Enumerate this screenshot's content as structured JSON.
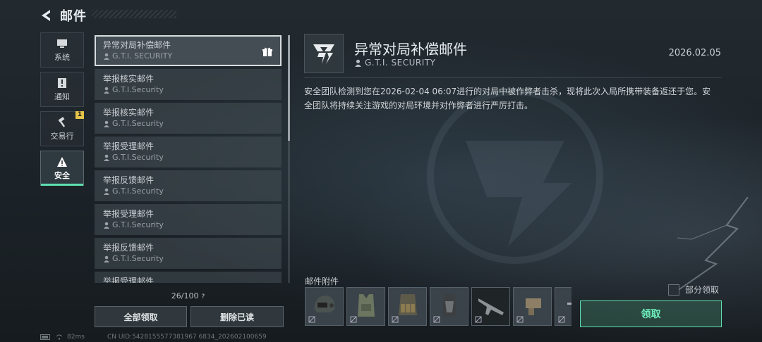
{
  "header": {
    "title": "邮件"
  },
  "sidebar": {
    "items": [
      {
        "label": "系统",
        "icon": "monitor-icon"
      },
      {
        "label": "通知",
        "icon": "notice-icon"
      },
      {
        "label": "交易行",
        "icon": "hammer-icon",
        "badge": "1"
      },
      {
        "label": "安全",
        "icon": "warning-icon",
        "active": true
      }
    ]
  },
  "mail_list": {
    "items": [
      {
        "subject": "异常对局补偿邮件",
        "sender": "G.T.I. SECURITY",
        "has_gift": true,
        "selected": true
      },
      {
        "subject": "举报核实邮件",
        "sender": "G.T.I.Security"
      },
      {
        "subject": "举报核实邮件",
        "sender": "G.T.I.Security"
      },
      {
        "subject": "举报受理邮件",
        "sender": "G.T.I.Security"
      },
      {
        "subject": "举报反馈邮件",
        "sender": "G.T.I.Security"
      },
      {
        "subject": "举报受理邮件",
        "sender": "G.T.I.Security"
      },
      {
        "subject": "举报反馈邮件",
        "sender": "G.T.I.Security"
      },
      {
        "subject": "举报受理邮件",
        "sender": ""
      }
    ],
    "count": "26/100",
    "count_help": "?",
    "claim_all_label": "全部领取",
    "delete_read_label": "删除已读"
  },
  "detail": {
    "title": "异常对局补偿邮件",
    "sender": "G.T.I. SECURITY",
    "date": "2026.02.05",
    "body": "安全团队检测到您在2026-02-04 06:07进行的对局中被作弊者击杀，现将此次入局所携带装备返还于您。安全团队将持续关注游戏的对局环境并对作弊者进行严厉打击。",
    "attachments_label": "邮件附件",
    "attachments": [
      {
        "icon": "helmet-icon"
      },
      {
        "icon": "armor-vest-icon"
      },
      {
        "icon": "chest-rig-icon"
      },
      {
        "icon": "backpack-icon"
      },
      {
        "icon": "rifle-icon"
      },
      {
        "icon": "gear-part-icon"
      },
      {
        "icon": "item-partial-icon"
      }
    ],
    "partial_claim_label": "部分领取",
    "claim_label": "领取"
  },
  "footer": {
    "ping": "82ms",
    "uid": "CN UID:5428155577381967 6834_202602100659"
  },
  "colors": {
    "accent": "#5ee0b0",
    "badge": "#e4c44a"
  }
}
